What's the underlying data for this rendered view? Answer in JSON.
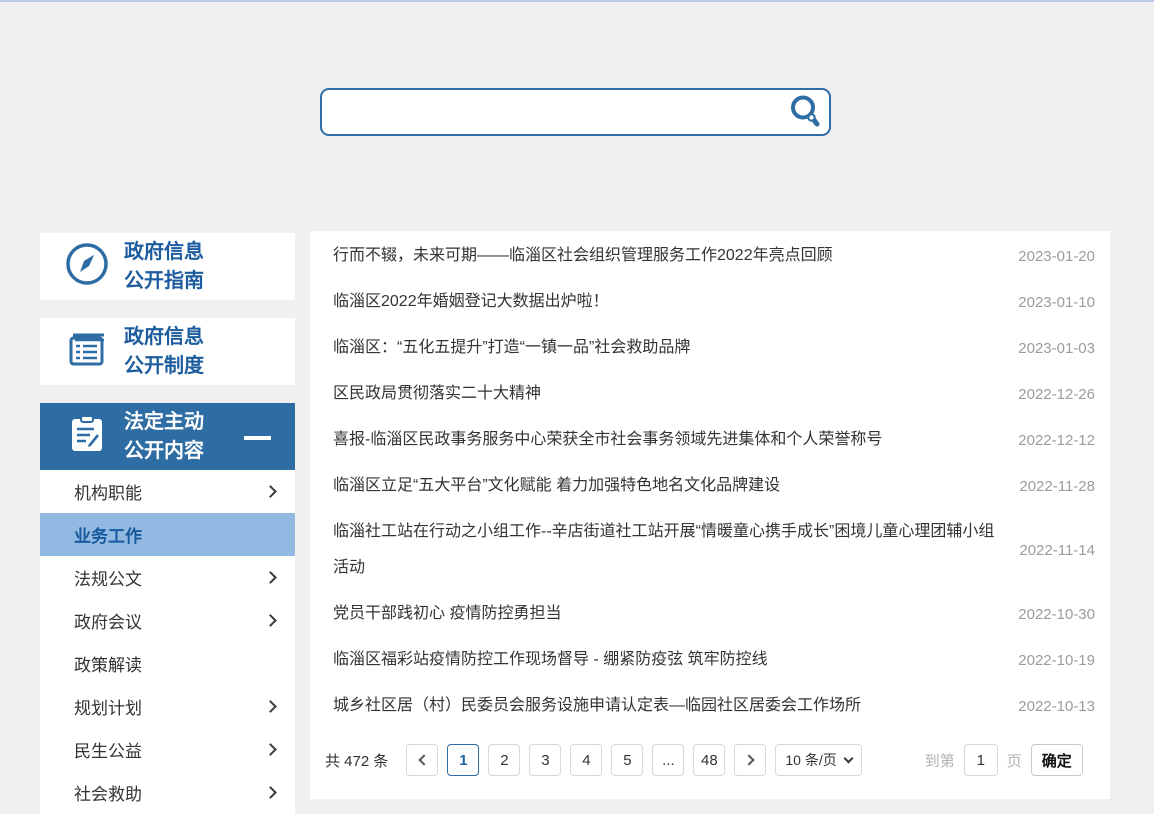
{
  "colors": {
    "primary_blue": "#2e6da4",
    "sidebar_text_blue": "#1d5c9e",
    "active_submenu_bg": "#92b9e2",
    "active_submenu_text": "#17599c",
    "top_line": "#b9c9e8",
    "page_bg": "#f0f0f1",
    "date_gray": "#9c9c9c"
  },
  "search": {
    "value": "",
    "placeholder": ""
  },
  "sidebar": {
    "groups": [
      {
        "line1": "政府信息",
        "line2": "公开指南",
        "icon": "compass-icon",
        "active": false
      },
      {
        "line1": "政府信息",
        "line2": "公开制度",
        "icon": "ledger-icon",
        "active": false
      },
      {
        "line1": "法定主动",
        "line2": "公开内容",
        "icon": "clipboard-pencil-icon",
        "active": true
      }
    ],
    "submenu": [
      {
        "label": "机构职能"
      },
      {
        "label": "业务工作"
      },
      {
        "label": "法规公文"
      },
      {
        "label": "政府会议"
      },
      {
        "label": "政策解读"
      },
      {
        "label": "规划计划"
      },
      {
        "label": "民生公益"
      },
      {
        "label": "社会救助"
      }
    ]
  },
  "articles": [
    {
      "title": "行而不辍，未来可期——临淄区社会组织管理服务工作2022年亮点回顾",
      "date": "2023-01-20"
    },
    {
      "title": "临淄区2022年婚姻登记大数据出炉啦！",
      "date": "2023-01-10"
    },
    {
      "title": "临淄区：“五化五提升”打造“一镇一品”社会救助品牌",
      "date": "2023-01-03"
    },
    {
      "title": "区民政局贯彻落实二十大精神",
      "date": "2022-12-26"
    },
    {
      "title": "喜报-临淄区民政事务服务中心荣获全市社会事务领域先进集体和个人荣誉称号",
      "date": "2022-12-12"
    },
    {
      "title": "临淄区立足“五大平台”文化赋能 着力加强特色地名文化品牌建设",
      "date": "2022-11-28"
    },
    {
      "title": "临淄社工站在行动之小组工作--辛店街道社工站开展“情暖童心携手成长”困境儿童心理团辅小组活动",
      "date": "2022-11-14"
    },
    {
      "title": "党员干部践初心 疫情防控勇担当",
      "date": "2022-10-30"
    },
    {
      "title": "临淄区福彩站疫情防控工作现场督导 - 绷紧防疫弦 筑牢防控线",
      "date": "2022-10-19"
    },
    {
      "title": "城乡社区居（村）民委员会服务设施申请认定表—临园社区居委会工作场所",
      "date": "2022-10-13"
    }
  ],
  "pagination": {
    "total": "共 472 条",
    "pages": [
      {
        "label": "1"
      },
      {
        "label": "2"
      },
      {
        "label": "3"
      },
      {
        "label": "4"
      },
      {
        "label": "5"
      },
      {
        "label": "..."
      },
      {
        "label": "48"
      }
    ],
    "active_page": "1",
    "page_size": "10 条/页",
    "goto_prefix": "到第",
    "goto_value": "1",
    "goto_suffix": "页",
    "confirm_label": "确定"
  }
}
